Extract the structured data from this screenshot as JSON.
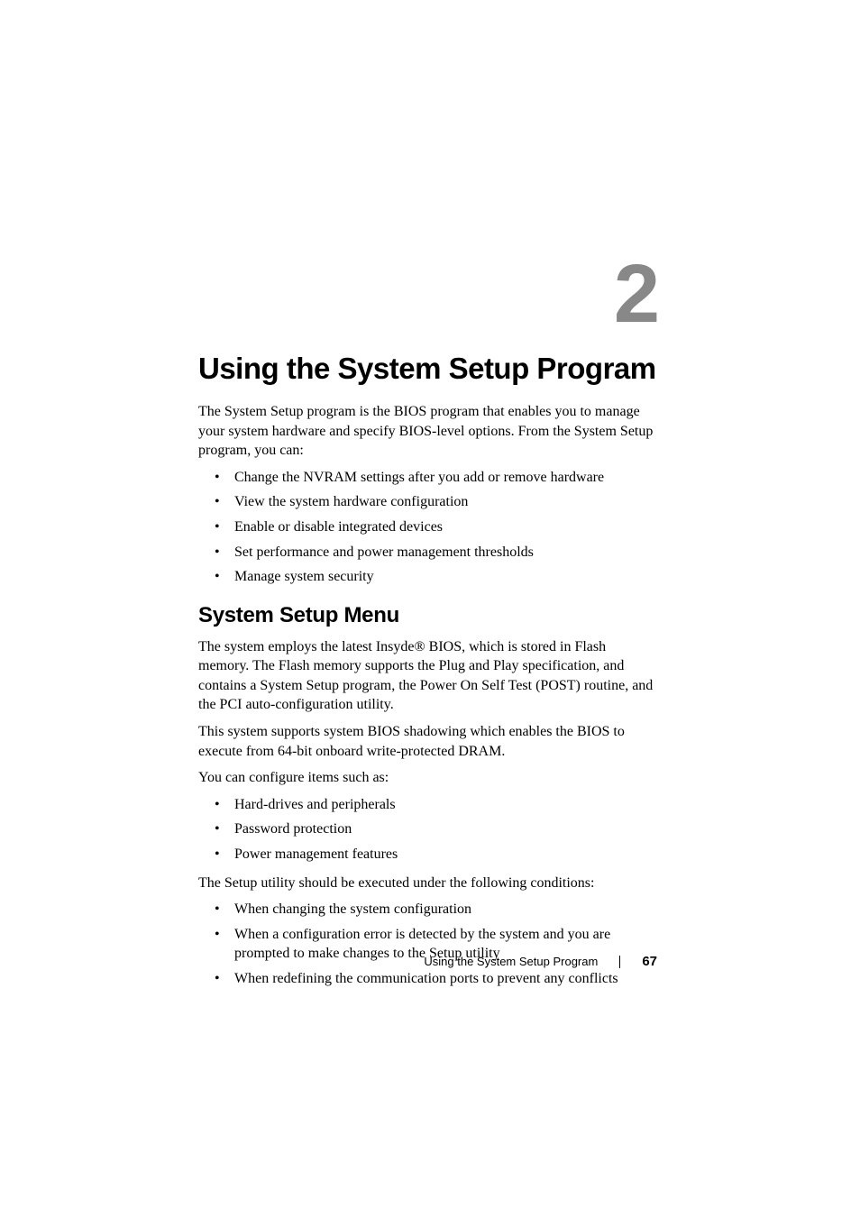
{
  "chapter": {
    "number": "2"
  },
  "title": "Using the System Setup Program",
  "intro": "The System Setup program is the BIOS program that enables you to manage your system hardware and specify BIOS-level options. From the System Setup program, you can:",
  "intro_bullets": [
    "Change the NVRAM settings after you add or remove hardware",
    "View the system hardware configuration",
    "Enable or disable integrated devices",
    "Set performance and power management thresholds",
    "Manage system security"
  ],
  "section1": {
    "heading": "System Setup Menu",
    "para1": "The system employs the latest Insyde® BIOS, which is stored in Flash memory. The Flash memory supports the Plug and Play specification, and contains a System Setup program, the Power On Self Test (POST) routine, and the PCI auto-configuration utility.",
    "para2": "This system supports system BIOS shadowing which enables the BIOS to execute from 64-bit onboard write-protected DRAM.",
    "para3": "You can configure items such as:",
    "bullets1": [
      "Hard-drives and peripherals",
      "Password protection",
      "Power management features"
    ],
    "para4": "The Setup utility should be executed under the following conditions:",
    "bullets2": [
      "When changing the system configuration",
      "When a configuration error is detected by the system and you are prompted to make changes to the Setup utility",
      "When redefining the communication ports to prevent any conflicts"
    ]
  },
  "footer": {
    "section_name": "Using the System Setup Program",
    "page_number": "67"
  }
}
